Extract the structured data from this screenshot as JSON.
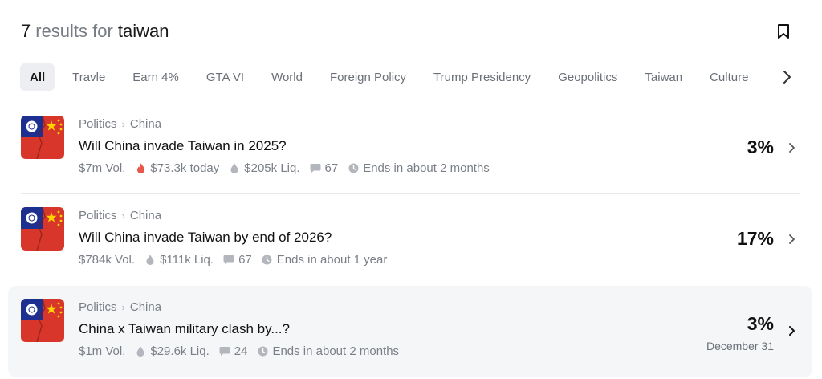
{
  "header": {
    "count": "7",
    "middle": "results for",
    "query": "taiwan",
    "bookmark_icon": "bookmark-icon"
  },
  "tabs": [
    {
      "label": "All",
      "active": true
    },
    {
      "label": "Travle"
    },
    {
      "label": "Earn 4%"
    },
    {
      "label": "GTA VI"
    },
    {
      "label": "World"
    },
    {
      "label": "Foreign Policy"
    },
    {
      "label": "Trump Presidency"
    },
    {
      "label": "Geopolitics"
    },
    {
      "label": "Taiwan"
    },
    {
      "label": "Culture"
    }
  ],
  "results": [
    {
      "category": "Politics",
      "subcategory": "China",
      "title": "Will China invade Taiwan in 2025?",
      "volume": "$7m Vol.",
      "today": "$73.3k today",
      "liquidity": "$205k Liq.",
      "comments": "67",
      "ends": "Ends in about 2 months",
      "percent": "3%"
    },
    {
      "category": "Politics",
      "subcategory": "China",
      "title": "Will China invade Taiwan by end of 2026?",
      "volume": "$784k Vol.",
      "liquidity": "$111k Liq.",
      "comments": "67",
      "ends": "Ends in about 1 year",
      "percent": "17%"
    },
    {
      "category": "Politics",
      "subcategory": "China",
      "title": "China x Taiwan military clash by...?",
      "volume": "$1m Vol.",
      "liquidity": "$29.6k Liq.",
      "comments": "24",
      "ends": "Ends in about 2 months",
      "percent": "3%",
      "outcome": "December 31"
    }
  ],
  "colors": {
    "muted_text": "#7a7f87",
    "hover_bg": "#f5f6f8",
    "fire": "#e8574a"
  }
}
